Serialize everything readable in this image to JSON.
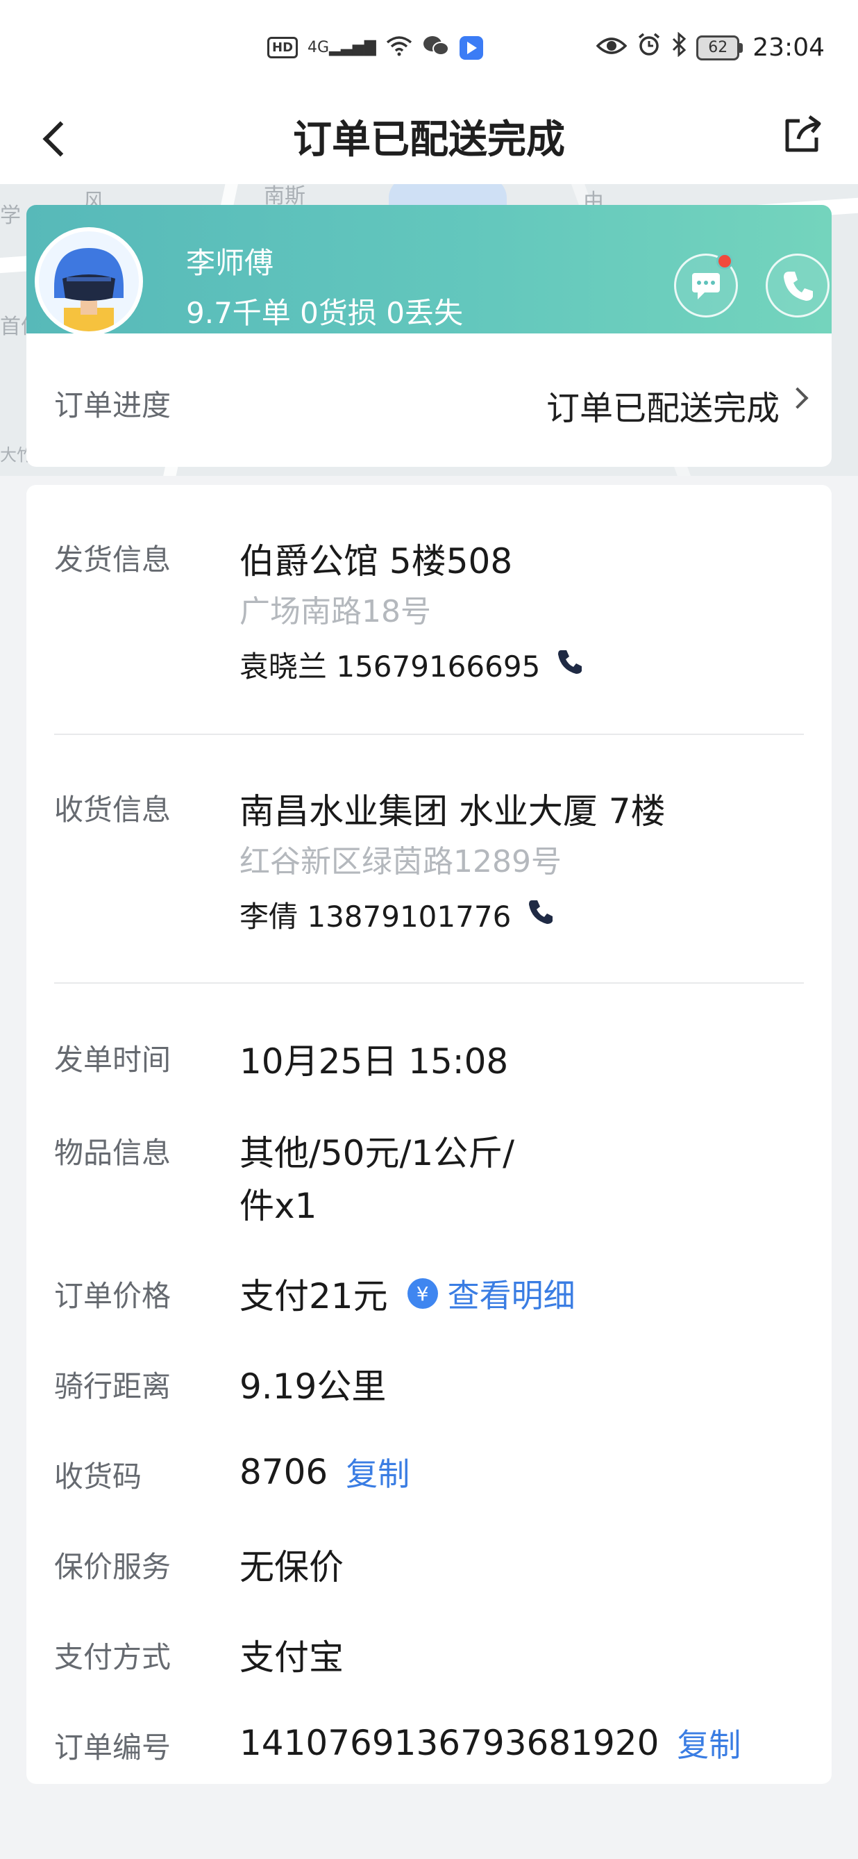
{
  "status_bar": {
    "time": "23:04",
    "battery": "62",
    "hd": "HD",
    "network": "4G"
  },
  "nav": {
    "title": "订单已配送完成"
  },
  "courier": {
    "name": "李师傅",
    "stats": "9.7千单 0货损 0丢失"
  },
  "progress": {
    "label": "订单进度",
    "value": "订单已配送完成"
  },
  "sender": {
    "label": "发货信息",
    "address": "伯爵公馆 5楼508",
    "street": "广场南路18号",
    "contact": "袁晓兰 15679166695"
  },
  "receiver": {
    "label": "收货信息",
    "address": "南昌水业集团 水业大厦 7楼",
    "street": "红谷新区绿茵路1289号",
    "contact": "李倩 13879101776"
  },
  "details": {
    "order_time": {
      "label": "发单时间",
      "value": "10月25日 15:08"
    },
    "item_info": {
      "label": "物品信息",
      "line1": "其他/50元/1公斤/",
      "line2": "件x1"
    },
    "order_price": {
      "label": "订单价格",
      "value": "支付21元",
      "icon": "¥",
      "link": "查看明细"
    },
    "ride_distance": {
      "label": "骑行距离",
      "value": "9.19公里"
    },
    "receive_code": {
      "label": "收货码",
      "value": "8706",
      "link": "复制"
    },
    "insurance": {
      "label": "保价服务",
      "value": "无保价"
    },
    "payment_method": {
      "label": "支付方式",
      "value": "支付宝"
    },
    "order_no": {
      "label": "订单编号",
      "value": "1410769136793681920",
      "link": "复制"
    }
  },
  "map_labels": [
    "学",
    "风",
    "南斯",
    "由",
    "首仿",
    "大竹馆"
  ],
  "colors": {
    "header_gradient_start": "#57b9b9",
    "header_gradient_end": "#74d4bd",
    "link": "#3a7de3",
    "badge_red": "#f14a3c"
  }
}
